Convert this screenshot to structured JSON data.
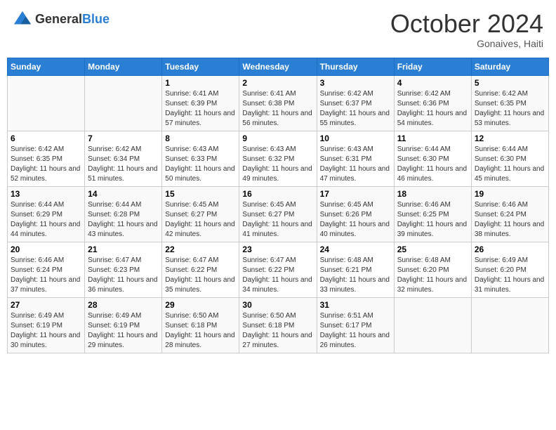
{
  "header": {
    "logo": {
      "general": "General",
      "blue": "Blue"
    },
    "title": "October 2024",
    "subtitle": "Gonaives, Haiti"
  },
  "calendar": {
    "days_of_week": [
      "Sunday",
      "Monday",
      "Tuesday",
      "Wednesday",
      "Thursday",
      "Friday",
      "Saturday"
    ],
    "weeks": [
      [
        {
          "day": "",
          "empty": true
        },
        {
          "day": "",
          "empty": true
        },
        {
          "day": "1",
          "sunrise": "Sunrise: 6:41 AM",
          "sunset": "Sunset: 6:39 PM",
          "daylight": "Daylight: 11 hours and 57 minutes."
        },
        {
          "day": "2",
          "sunrise": "Sunrise: 6:41 AM",
          "sunset": "Sunset: 6:38 PM",
          "daylight": "Daylight: 11 hours and 56 minutes."
        },
        {
          "day": "3",
          "sunrise": "Sunrise: 6:42 AM",
          "sunset": "Sunset: 6:37 PM",
          "daylight": "Daylight: 11 hours and 55 minutes."
        },
        {
          "day": "4",
          "sunrise": "Sunrise: 6:42 AM",
          "sunset": "Sunset: 6:36 PM",
          "daylight": "Daylight: 11 hours and 54 minutes."
        },
        {
          "day": "5",
          "sunrise": "Sunrise: 6:42 AM",
          "sunset": "Sunset: 6:35 PM",
          "daylight": "Daylight: 11 hours and 53 minutes."
        }
      ],
      [
        {
          "day": "6",
          "sunrise": "Sunrise: 6:42 AM",
          "sunset": "Sunset: 6:35 PM",
          "daylight": "Daylight: 11 hours and 52 minutes."
        },
        {
          "day": "7",
          "sunrise": "Sunrise: 6:42 AM",
          "sunset": "Sunset: 6:34 PM",
          "daylight": "Daylight: 11 hours and 51 minutes."
        },
        {
          "day": "8",
          "sunrise": "Sunrise: 6:43 AM",
          "sunset": "Sunset: 6:33 PM",
          "daylight": "Daylight: 11 hours and 50 minutes."
        },
        {
          "day": "9",
          "sunrise": "Sunrise: 6:43 AM",
          "sunset": "Sunset: 6:32 PM",
          "daylight": "Daylight: 11 hours and 49 minutes."
        },
        {
          "day": "10",
          "sunrise": "Sunrise: 6:43 AM",
          "sunset": "Sunset: 6:31 PM",
          "daylight": "Daylight: 11 hours and 47 minutes."
        },
        {
          "day": "11",
          "sunrise": "Sunrise: 6:44 AM",
          "sunset": "Sunset: 6:30 PM",
          "daylight": "Daylight: 11 hours and 46 minutes."
        },
        {
          "day": "12",
          "sunrise": "Sunrise: 6:44 AM",
          "sunset": "Sunset: 6:30 PM",
          "daylight": "Daylight: 11 hours and 45 minutes."
        }
      ],
      [
        {
          "day": "13",
          "sunrise": "Sunrise: 6:44 AM",
          "sunset": "Sunset: 6:29 PM",
          "daylight": "Daylight: 11 hours and 44 minutes."
        },
        {
          "day": "14",
          "sunrise": "Sunrise: 6:44 AM",
          "sunset": "Sunset: 6:28 PM",
          "daylight": "Daylight: 11 hours and 43 minutes."
        },
        {
          "day": "15",
          "sunrise": "Sunrise: 6:45 AM",
          "sunset": "Sunset: 6:27 PM",
          "daylight": "Daylight: 11 hours and 42 minutes."
        },
        {
          "day": "16",
          "sunrise": "Sunrise: 6:45 AM",
          "sunset": "Sunset: 6:27 PM",
          "daylight": "Daylight: 11 hours and 41 minutes."
        },
        {
          "day": "17",
          "sunrise": "Sunrise: 6:45 AM",
          "sunset": "Sunset: 6:26 PM",
          "daylight": "Daylight: 11 hours and 40 minutes."
        },
        {
          "day": "18",
          "sunrise": "Sunrise: 6:46 AM",
          "sunset": "Sunset: 6:25 PM",
          "daylight": "Daylight: 11 hours and 39 minutes."
        },
        {
          "day": "19",
          "sunrise": "Sunrise: 6:46 AM",
          "sunset": "Sunset: 6:24 PM",
          "daylight": "Daylight: 11 hours and 38 minutes."
        }
      ],
      [
        {
          "day": "20",
          "sunrise": "Sunrise: 6:46 AM",
          "sunset": "Sunset: 6:24 PM",
          "daylight": "Daylight: 11 hours and 37 minutes."
        },
        {
          "day": "21",
          "sunrise": "Sunrise: 6:47 AM",
          "sunset": "Sunset: 6:23 PM",
          "daylight": "Daylight: 11 hours and 36 minutes."
        },
        {
          "day": "22",
          "sunrise": "Sunrise: 6:47 AM",
          "sunset": "Sunset: 6:22 PM",
          "daylight": "Daylight: 11 hours and 35 minutes."
        },
        {
          "day": "23",
          "sunrise": "Sunrise: 6:47 AM",
          "sunset": "Sunset: 6:22 PM",
          "daylight": "Daylight: 11 hours and 34 minutes."
        },
        {
          "day": "24",
          "sunrise": "Sunrise: 6:48 AM",
          "sunset": "Sunset: 6:21 PM",
          "daylight": "Daylight: 11 hours and 33 minutes."
        },
        {
          "day": "25",
          "sunrise": "Sunrise: 6:48 AM",
          "sunset": "Sunset: 6:20 PM",
          "daylight": "Daylight: 11 hours and 32 minutes."
        },
        {
          "day": "26",
          "sunrise": "Sunrise: 6:49 AM",
          "sunset": "Sunset: 6:20 PM",
          "daylight": "Daylight: 11 hours and 31 minutes."
        }
      ],
      [
        {
          "day": "27",
          "sunrise": "Sunrise: 6:49 AM",
          "sunset": "Sunset: 6:19 PM",
          "daylight": "Daylight: 11 hours and 30 minutes."
        },
        {
          "day": "28",
          "sunrise": "Sunrise: 6:49 AM",
          "sunset": "Sunset: 6:19 PM",
          "daylight": "Daylight: 11 hours and 29 minutes."
        },
        {
          "day": "29",
          "sunrise": "Sunrise: 6:50 AM",
          "sunset": "Sunset: 6:18 PM",
          "daylight": "Daylight: 11 hours and 28 minutes."
        },
        {
          "day": "30",
          "sunrise": "Sunrise: 6:50 AM",
          "sunset": "Sunset: 6:18 PM",
          "daylight": "Daylight: 11 hours and 27 minutes."
        },
        {
          "day": "31",
          "sunrise": "Sunrise: 6:51 AM",
          "sunset": "Sunset: 6:17 PM",
          "daylight": "Daylight: 11 hours and 26 minutes."
        },
        {
          "day": "",
          "empty": true
        },
        {
          "day": "",
          "empty": true
        }
      ]
    ]
  }
}
